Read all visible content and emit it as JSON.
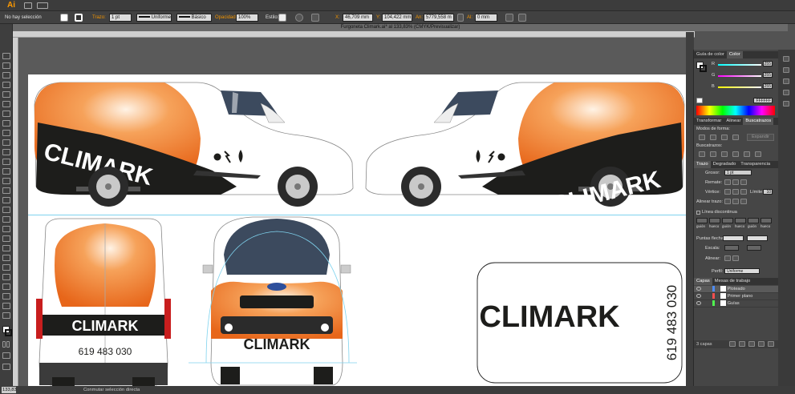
{
  "app": {
    "logo": "Ai"
  },
  "control_bar": {
    "selection": "No hay selección",
    "stroke_label": "Trazo:",
    "stroke_weight": "1 pt",
    "profile_value": "Uniforme",
    "brush_value": "Básico",
    "opacity_label": "Opacidad:",
    "opacity_value": "100%",
    "style_label": "Estilo:",
    "x_label": "X:",
    "x_value": "46,709 mm",
    "y_label": "Y:",
    "y_value": "104,422 mm",
    "w_label": "An:",
    "w_value": "5779,558 m",
    "h_label": "Al:",
    "h_value": "0 mm"
  },
  "document": {
    "title": "Furgoneta Climark.ai* al 133,83% (CMYK/Previsualizar)"
  },
  "artwork": {
    "brand": "CLIMARK",
    "phone": "619 483 030",
    "colors": {
      "orange": "#ee7a21",
      "black": "#1d1d1b",
      "window": "#3c4a5e",
      "tire": "#2b2b2b",
      "guide": "#7fd3ee"
    }
  },
  "color_panel": {
    "tabs": [
      "Guía de color",
      "Color"
    ],
    "active_tab": "Color",
    "channels": [
      {
        "label": "R",
        "value": "255"
      },
      {
        "label": "G",
        "value": "255"
      },
      {
        "label": "B",
        "value": "255"
      }
    ],
    "hex_value": "FFFFFF"
  },
  "pathfinder_panel": {
    "tabs": [
      "Transformar",
      "Alinear",
      "Buscatrazos"
    ],
    "active_tab": "Buscatrazos",
    "shape_modes_label": "Modos de forma:",
    "expand_label": "Expandir",
    "pathfinders_label": "Buscatrazos:"
  },
  "stroke_panel": {
    "tabs": [
      "Trazo",
      "Degradado",
      "Transparencia"
    ],
    "active_tab": "Trazo",
    "weight_label": "Grosor:",
    "weight_value": "1 pt",
    "cap_label": "Remate:",
    "corner_label": "Vértice:",
    "limit_label": "Límite:",
    "limit_value": "10",
    "align_label": "Alinear trazo:",
    "dashed_label": "Línea discontinua",
    "dash_labels": [
      "guión",
      "hueco",
      "guión",
      "hueco",
      "guión",
      "hueco"
    ],
    "arrowheads_label": "Puntas flecha:",
    "scale_label": "Escala:",
    "align_arrow_label": "Alinear:",
    "profile_label": "Perfil:",
    "profile_value": "Uniforme"
  },
  "layers_panel": {
    "tabs": [
      "Capas",
      "Mesas de trabajo"
    ],
    "active_tab": "Capas",
    "layers": [
      {
        "name": "Ploteado",
        "color": "#4f8cf2"
      },
      {
        "name": "Primer plano",
        "color": "#f24f4f"
      },
      {
        "name": "Guías",
        "color": "#4ff24f"
      }
    ],
    "count_label": "3 capas"
  },
  "status_bar": {
    "zoom": "133,83",
    "tool_status": "Conmutar selección directa"
  }
}
